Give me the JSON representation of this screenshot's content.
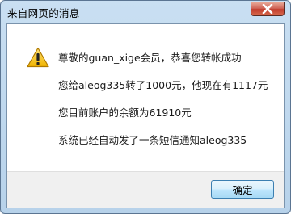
{
  "window": {
    "title": "来自网页的消息"
  },
  "dialog": {
    "icon": "warning-icon",
    "lines": [
      "尊敬的guan_xige会员，恭喜您转帐成功",
      "您给aleog335转了1000元，他现在有1117元",
      "您目前账户的余额为61910元",
      "系统已经自动发了一条短信通知aleog335"
    ],
    "ok_label": "确定"
  },
  "colors": {
    "frame": "#b7d2ea",
    "close": "#c13b2c",
    "warning": "#f2c21b"
  }
}
